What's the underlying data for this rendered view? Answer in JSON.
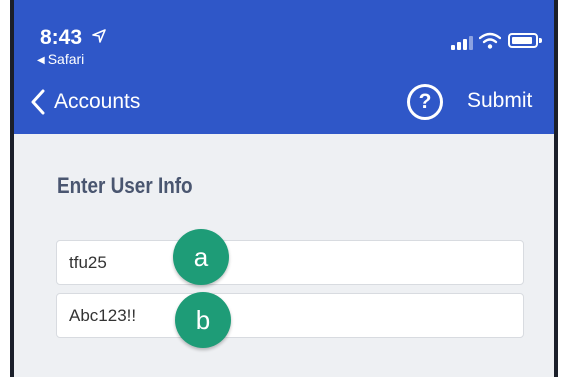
{
  "status_bar": {
    "time": "8:43",
    "back_app_label": "Safari",
    "icons": [
      "location-arrow-icon",
      "cellular-signal-icon",
      "wifi-icon",
      "battery-icon"
    ]
  },
  "nav": {
    "back_label": "Accounts",
    "help_label": "?",
    "submit_label": "Submit",
    "bar_color": "#2f57c8"
  },
  "form": {
    "title": "Enter User Info",
    "username_value": "tfu25",
    "password_value": "Abc123!!"
  },
  "callouts": {
    "a_label": "a",
    "b_label": "b",
    "color": "#1e9c77"
  }
}
